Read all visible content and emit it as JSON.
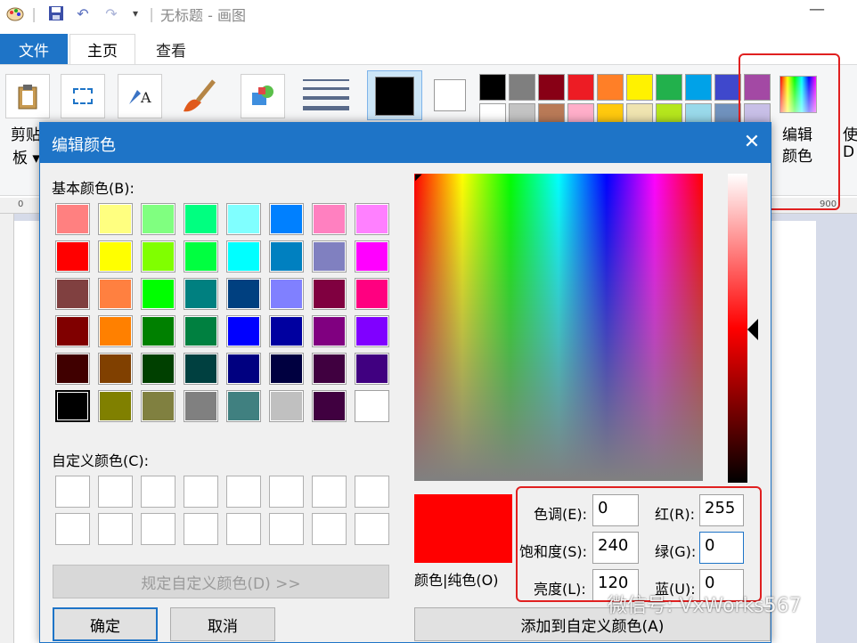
{
  "title_bar": {
    "title": "无标题 - 画图",
    "minimize_glyph": "—"
  },
  "tabs": [
    {
      "label": "文件"
    },
    {
      "label": "主页"
    },
    {
      "label": "查看"
    }
  ],
  "ribbon": {
    "clipboard_label_1": "剪贴",
    "clipboard_label_2": "板 ▾",
    "edit_colors_label_1": "编辑",
    "edit_colors_label_2": "颜色",
    "cut_off_label_1": "使",
    "cut_off_label_2": "D",
    "ruler_marks": [
      "0",
      "900"
    ],
    "palette_row1": [
      "#000000",
      "#7f7f7f",
      "#880015",
      "#ed1c24",
      "#ff7f27",
      "#fff200",
      "#22b14c",
      "#00a2e8",
      "#3f48cc",
      "#a349a4"
    ],
    "palette_row2": [
      "#ffffff",
      "#c3c3c3",
      "#b97a57",
      "#ffaec9",
      "#ffc90e",
      "#efe4b0",
      "#b5e61d",
      "#99d9ea",
      "#7092be",
      "#c8bfe7"
    ]
  },
  "dialog": {
    "title": "编辑颜色",
    "close_glyph": "✕",
    "basic_colors_label": "基本颜色(B):",
    "basic_colors": [
      [
        "#ff8080",
        "#ffff80",
        "#80ff80",
        "#00ff80",
        "#80ffff",
        "#0080ff",
        "#ff80c0",
        "#ff80ff"
      ],
      [
        "#ff0000",
        "#ffff00",
        "#80ff00",
        "#00ff40",
        "#00ffff",
        "#0080c0",
        "#8080c0",
        "#ff00ff"
      ],
      [
        "#804040",
        "#ff8040",
        "#00ff00",
        "#008080",
        "#004080",
        "#8080ff",
        "#800040",
        "#ff0080"
      ],
      [
        "#800000",
        "#ff8000",
        "#008000",
        "#008040",
        "#0000ff",
        "#0000a0",
        "#800080",
        "#8000ff"
      ],
      [
        "#400000",
        "#804000",
        "#004000",
        "#004040",
        "#000080",
        "#000040",
        "#400040",
        "#400080"
      ],
      [
        "#000000",
        "#808000",
        "#808040",
        "#808080",
        "#408080",
        "#c0c0c0",
        "#400040",
        "#ffffff"
      ]
    ],
    "selected_basic": "#000000",
    "custom_colors_label": "自定义颜色(C):",
    "define_custom_button": "规定自定义颜色(D) >>",
    "ok_button": "确定",
    "cancel_button": "取消",
    "preview_label": "颜色|纯色(O)",
    "preview_color": "#ff0000",
    "hue_label": "色调(E):",
    "hue_value": "0",
    "sat_label": "饱和度(S):",
    "sat_value": "240",
    "lum_label": "亮度(L):",
    "lum_value": "120",
    "red_label": "红(R):",
    "red_value": "255",
    "green_label": "绿(G):",
    "green_value": "0",
    "blue_label": "蓝(U):",
    "blue_value": "0",
    "add_custom_button": "添加到自定义颜色(A)"
  },
  "watermark": "微信号: VxWorks567"
}
